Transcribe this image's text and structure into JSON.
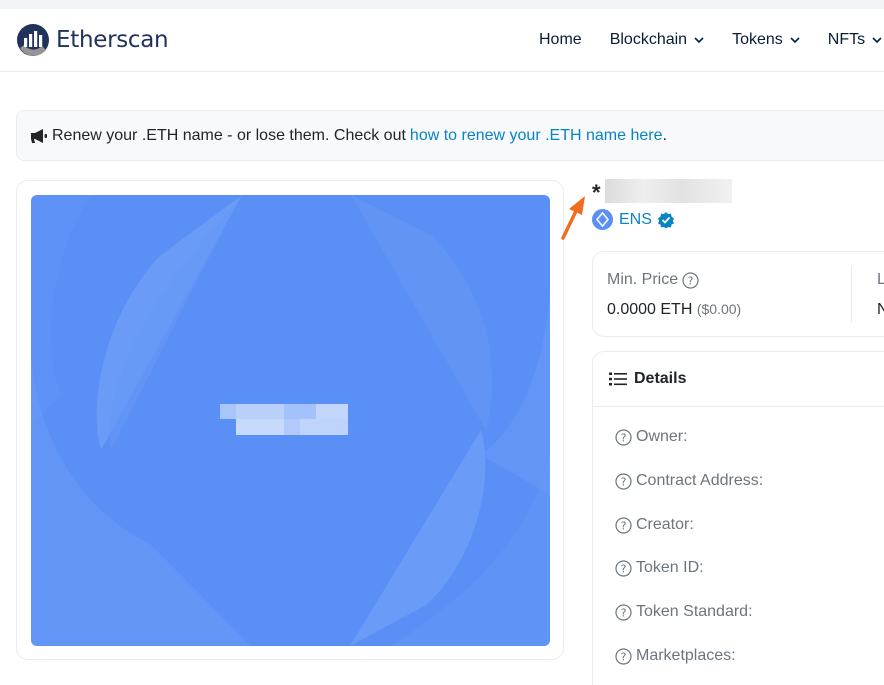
{
  "header": {
    "logo_text": "Etherscan",
    "nav": [
      {
        "label": "Home",
        "dropdown": false
      },
      {
        "label": "Blockchain",
        "dropdown": true
      },
      {
        "label": "Tokens",
        "dropdown": true
      },
      {
        "label": "NFTs",
        "dropdown": true
      }
    ]
  },
  "banner": {
    "text": "Renew your .ETH name - or lose them. Check out",
    "link_text": "how to renew your .ETH name here",
    "suffix": "."
  },
  "token": {
    "title": "*",
    "collection": "ENS"
  },
  "price": {
    "min_label": "Min. Price",
    "min_value": "0.0000 ETH",
    "min_usd": "($0.00)",
    "second_label": "L",
    "second_value": "N"
  },
  "details": {
    "heading": "Details",
    "rows": [
      "Owner:",
      "Contract Address:",
      "Creator:",
      "Token ID:",
      "Token Standard:",
      "Marketplaces:"
    ]
  },
  "colors": {
    "brand_dark": "#21325b",
    "link": "#0784c3",
    "ens_blue": "#5a8ff5",
    "annotation_arrow": "#f06d1f"
  },
  "icons": {
    "banner": "megaphone-icon",
    "details": "list-icon",
    "help": "question-circle-icon",
    "verified": "verified-badge-icon"
  }
}
